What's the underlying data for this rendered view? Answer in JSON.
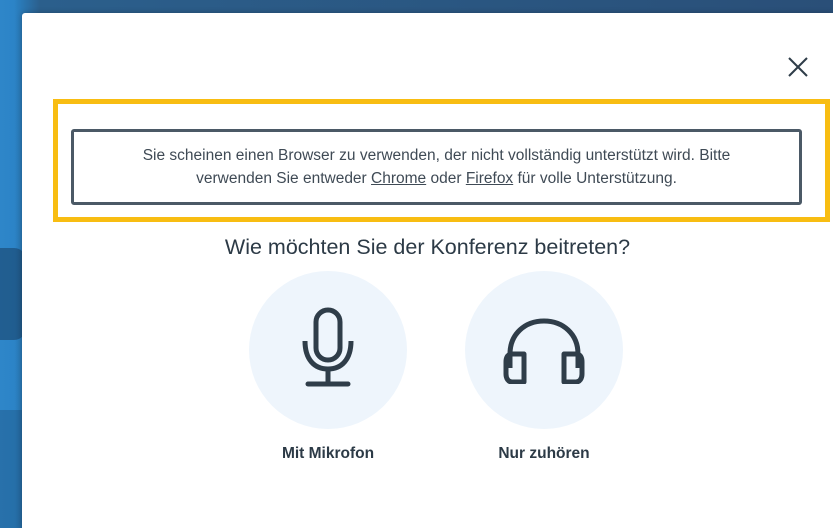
{
  "warning": {
    "line1": "Sie scheinen einen Browser zu verwenden, der nicht vollständig unterstützt wird. Bitte",
    "line2_prefix": "verwenden Sie entweder ",
    "chrome_link": "Chrome",
    "line2_middle": " oder ",
    "firefox_link": "Firefox",
    "line2_suffix": " für volle Unterstützung."
  },
  "dialog": {
    "title": "Wie möchten Sie der Konferenz beitreten?",
    "close_icon": "close-icon"
  },
  "options": [
    {
      "label": "Mit Mikrofon",
      "icon": "microphone-icon"
    },
    {
      "label": "Nur zuhören",
      "icon": "headphones-icon"
    }
  ],
  "colors": {
    "highlight": "#f8bd12",
    "warning_border": "#4b5966",
    "text": "#2c3a46",
    "option_bg": "#eef5fc",
    "icon": "#2f3d49"
  }
}
